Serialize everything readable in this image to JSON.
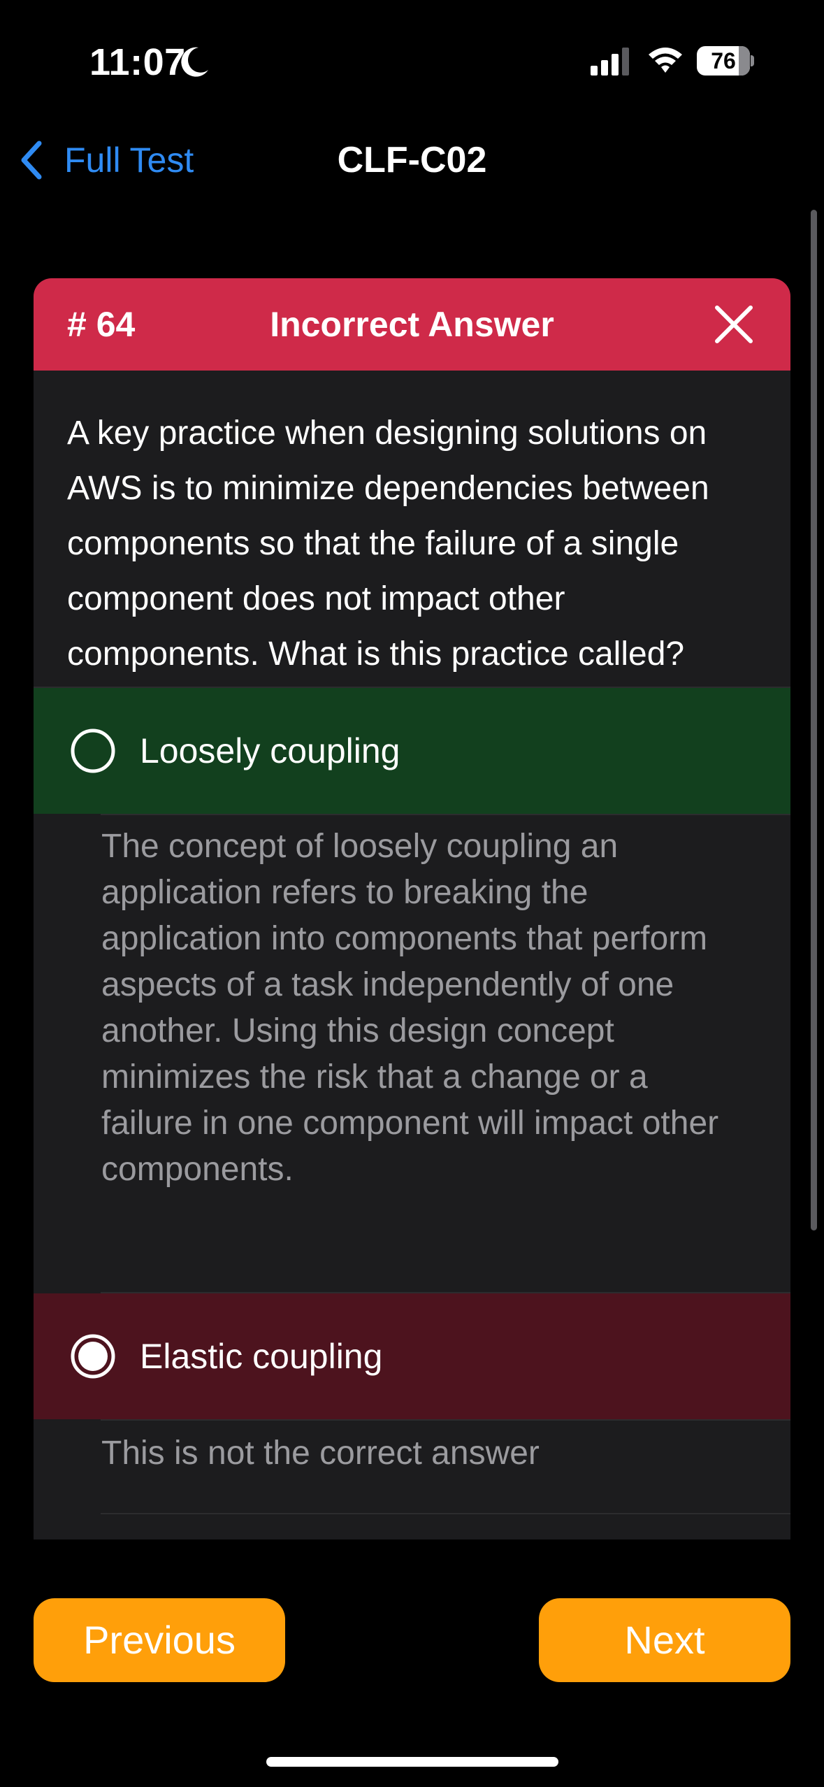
{
  "status_bar": {
    "time": "11:07",
    "battery": "76"
  },
  "nav": {
    "back_label": "Full Test",
    "title": "CLF-C02"
  },
  "card": {
    "number": "# 64",
    "header_title": "Incorrect Answer",
    "header_color": "#cf2a49",
    "question": "A key practice when designing solutions on AWS is to minimize dependencies between components so that the failure of a single component does not impact other components. What is this practice called?",
    "options": [
      {
        "label": "Loosely coupling",
        "state": "correct",
        "selected": false,
        "explanation": " The concept of loosely coupling an application refers to breaking the application into components that perform aspects of a task independently of one another. Using this design concept minimizes the risk that a change or a failure in one component will impact other components."
      },
      {
        "label": "Elastic coupling",
        "state": "incorrect",
        "selected": true,
        "explanation": "This is not the correct answer"
      }
    ]
  },
  "buttons": {
    "previous": "Previous",
    "next": "Next",
    "color": "#ff9f0a"
  },
  "icons": {
    "moon": "moon-icon",
    "signal": "cellular-signal-icon",
    "wifi": "wifi-icon",
    "battery": "battery-icon",
    "back": "chevron-left-icon",
    "close": "close-icon",
    "radio_empty": "radio-unselected-icon",
    "radio_selected": "radio-selected-icon"
  }
}
